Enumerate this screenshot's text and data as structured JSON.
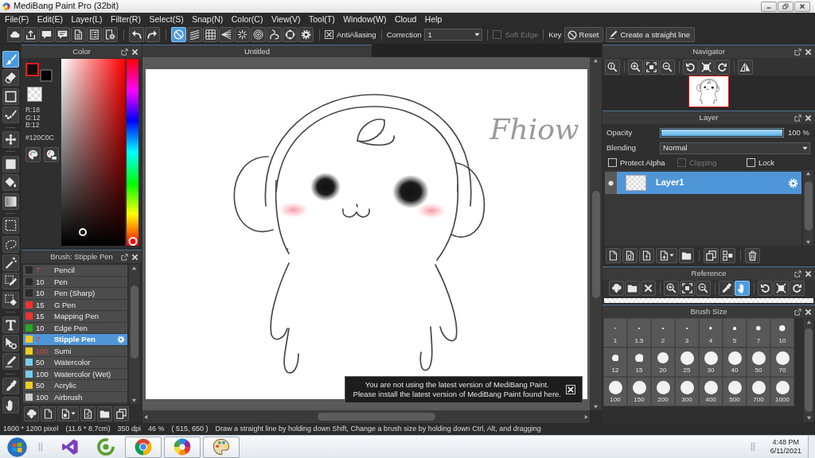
{
  "window": {
    "title": "MediBang Paint Pro (32bit)"
  },
  "menu": [
    "File(F)",
    "Edit(E)",
    "Layer(L)",
    "Filter(R)",
    "Select(S)",
    "Snap(N)",
    "Color(C)",
    "View(V)",
    "Tool(T)",
    "Window(W)",
    "Cloud",
    "Help"
  ],
  "toolbar": {
    "snap_buttons": [
      {
        "selected": true
      },
      {
        "selected": false
      },
      {
        "selected": false
      },
      {
        "selected": false
      },
      {
        "selected": false
      },
      {
        "selected": false
      },
      {
        "selected": false
      },
      {
        "selected": false
      },
      {
        "selected": false
      }
    ],
    "antialiasing": {
      "label": "AntiAliasing",
      "checked": true
    },
    "correction": {
      "label": "Correction",
      "value": "1"
    },
    "soft_edge": {
      "label": "Soft Edge",
      "checked": false,
      "disabled": true
    },
    "key": {
      "label": "Key"
    },
    "reset": {
      "label": "Reset"
    },
    "straight_line": {
      "label": "Create a straight line"
    }
  },
  "tools": [
    {
      "selected": true
    },
    {
      "selected": false
    },
    {
      "selected": false
    },
    {
      "selected": false
    },
    {
      "selected": false
    },
    {
      "selected": false
    },
    {
      "selected": false
    },
    {
      "selected": false
    },
    {
      "selected": false
    },
    {
      "selected": false
    },
    {
      "selected": false
    },
    {
      "selected": false
    },
    {
      "selected": false
    },
    {
      "selected": false
    },
    {
      "selected": false
    },
    {
      "selected": false
    },
    {
      "selected": false
    },
    {
      "selected": false
    }
  ],
  "color_panel": {
    "title": "Color",
    "swatches": [
      {
        "kind": "foreground",
        "color": "#120c0c",
        "selected": true
      },
      {
        "kind": "background",
        "color": "#000000",
        "selected": false
      }
    ],
    "rgb": [
      "R:18",
      "G:12",
      "B:12"
    ],
    "hex": "#120C0C",
    "hue_slider": {
      "level": 0
    }
  },
  "brush_panel": {
    "title": "Brush: Stipple Pen",
    "brushes": [
      {
        "name": "Pencil",
        "size": "7",
        "color": "#2a2a2a",
        "size_highlighted": true,
        "selected": false
      },
      {
        "name": "Pen",
        "size": "10",
        "color": "#2a2a2a",
        "size_highlighted": false,
        "selected": false
      },
      {
        "name": "Pen (Sharp)",
        "size": "10",
        "color": "#2a2a2a",
        "size_highlighted": false,
        "selected": false
      },
      {
        "name": "G Pen",
        "size": "15",
        "color": "#ee3333",
        "size_highlighted": false,
        "selected": false
      },
      {
        "name": "Mapping Pen",
        "size": "15",
        "color": "#ee3333",
        "size_highlighted": false,
        "selected": false
      },
      {
        "name": "Edge Pen",
        "size": "10",
        "color": "#22aa22",
        "size_highlighted": false,
        "selected": false
      },
      {
        "name": "Stipple Pen",
        "size": "7",
        "color": "#eecc22",
        "size_highlighted": true,
        "selected": true
      },
      {
        "name": "Sumi",
        "size": "100",
        "color": "#eecc22",
        "size_highlighted": true,
        "selected": false
      },
      {
        "name": "Watercolor",
        "size": "50",
        "color": "#77ccee",
        "size_highlighted": false,
        "selected": false
      },
      {
        "name": "Watercolor (Wet)",
        "size": "100",
        "color": "#77ccee",
        "size_highlighted": false,
        "selected": false
      },
      {
        "name": "Acrylic",
        "size": "50",
        "color": "#eecc22",
        "size_highlighted": false,
        "selected": false
      },
      {
        "name": "Airbrush",
        "size": "100",
        "color": "#cccccc",
        "size_highlighted": false,
        "selected": false
      }
    ]
  },
  "canvas": {
    "tab": "Untitled",
    "signature": "Fhiow"
  },
  "notification": {
    "message": "You are not using the latest version of MediBang Paint.\nPlease install the latest version of MediBang Paint found here."
  },
  "navigator": {
    "title": "Navigator"
  },
  "layer_panel": {
    "title": "Layer",
    "opacity": {
      "label": "Opacity",
      "level": 1.0,
      "reading": "100 %"
    },
    "blending": {
      "label": "Blending",
      "value": "Normal"
    },
    "options": [
      {
        "label": "Protect Alpha",
        "checked": false,
        "disabled": false
      },
      {
        "label": "Clipping",
        "checked": false,
        "disabled": true
      },
      {
        "label": "Lock",
        "checked": false,
        "disabled": false
      }
    ],
    "layers": [
      {
        "name": "Layer1",
        "visible": true,
        "selected": true
      }
    ]
  },
  "reference": {
    "title": "Reference",
    "tools": [
      {
        "selected": false
      },
      {
        "selected": false
      },
      {
        "selected": false
      },
      {
        "selected": false
      },
      {
        "selected": false
      },
      {
        "selected": false
      },
      {
        "selected": false
      },
      {
        "selected": true
      },
      {
        "selected": false
      },
      {
        "selected": false
      },
      {
        "selected": false
      }
    ]
  },
  "brush_size": {
    "title": "Brush Size",
    "sizes": [
      "1",
      "1.5",
      "2",
      "3",
      "4",
      "5",
      "7",
      "10",
      "12",
      "15",
      "20",
      "25",
      "30",
      "40",
      "50",
      "70",
      "100",
      "150",
      "200",
      "300",
      "400",
      "500",
      "700",
      "1000"
    ]
  },
  "status_bar": [
    "1600 * 1200 pixel",
    "(11.6 * 8.7cm)",
    "350 dpi",
    "46 %",
    "( 515, 650 )",
    "Draw a straight line by holding down Shift, Change a brush size by holding down Ctrl, Alt, and dragging"
  ],
  "taskbar": {
    "apps": [
      {
        "running": false
      },
      {
        "running": false
      },
      {
        "running": true
      },
      {
        "running": true
      },
      {
        "running": true
      }
    ],
    "clock": {
      "time": "4:48 PM",
      "date": "6/11/2021"
    }
  }
}
